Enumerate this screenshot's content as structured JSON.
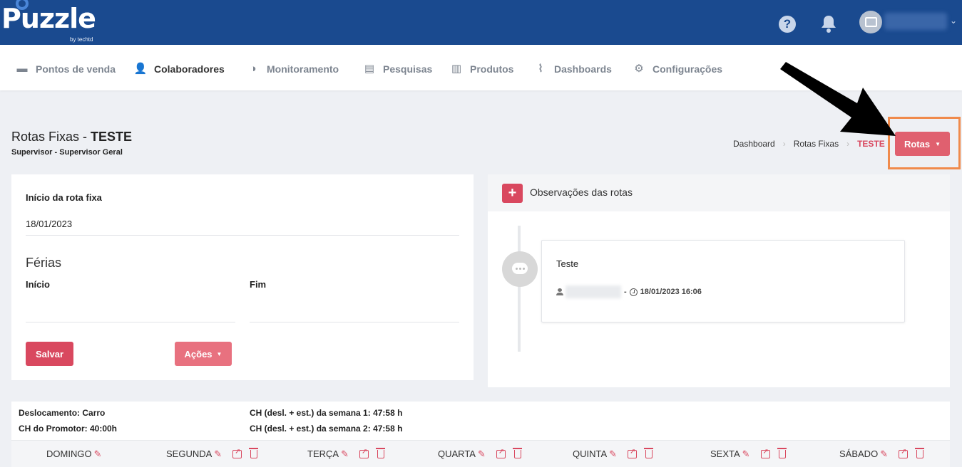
{
  "header": {
    "logo_text": "Puzzle",
    "logo_sub": "by techtd",
    "help_glyph": "?",
    "icons": [
      "help-icon",
      "bell-icon",
      "avatar"
    ],
    "colors": {
      "topbar": "#1a4a8f",
      "accent": "#d9485f"
    }
  },
  "nav": {
    "items": [
      {
        "label": "Pontos de venda",
        "icon": "store-icon",
        "glyph": "▬"
      },
      {
        "label": "Colaboradores",
        "icon": "users-icon",
        "glyph": "👤"
      },
      {
        "label": "Monitoramento",
        "icon": "monitoring-icon",
        "glyph": "◑"
      },
      {
        "label": "Pesquisas",
        "icon": "survey-icon",
        "glyph": "▤"
      },
      {
        "label": "Produtos",
        "icon": "barcode-icon",
        "glyph": "▥"
      },
      {
        "label": "Dashboards",
        "icon": "chart-icon",
        "glyph": "⌇"
      },
      {
        "label": "Configurações",
        "icon": "gears-icon",
        "glyph": "⚙"
      }
    ]
  },
  "page": {
    "title_prefix": "Rotas Fixas - ",
    "title_name": "TESTE",
    "subtitle": "Supervisor - Supervisor Geral",
    "breadcrumb": [
      "Dashboard",
      "Rotas Fixas",
      "TESTE"
    ],
    "breadcrumb_sep": "›",
    "rotas_button": "Rotas"
  },
  "form": {
    "start_label": "Início da rota fixa",
    "start_value": "18/01/2023",
    "vacation_heading": "Férias",
    "vacation_start_label": "Início",
    "vacation_end_label": "Fim",
    "save_button": "Salvar",
    "actions_button": "Ações"
  },
  "observations": {
    "title": "Observações das rotas",
    "add_glyph": "+",
    "entries": [
      {
        "text": "Teste",
        "separator": "-",
        "datetime": "18/01/2023 16:06"
      }
    ]
  },
  "summary": {
    "transport": "Deslocamento: Carro",
    "promoter_hours": "CH do Promotor: 40:00h",
    "week1": "CH (desl. + est.) da semana 1: 47:58 h",
    "week2": "CH (desl. + est.) da semana 2: 47:58 h"
  },
  "days": [
    "DOMINGO",
    "SEGUNDA",
    "TERÇA",
    "QUARTA",
    "QUINTA",
    "SEXTA",
    "SÁBADO"
  ]
}
